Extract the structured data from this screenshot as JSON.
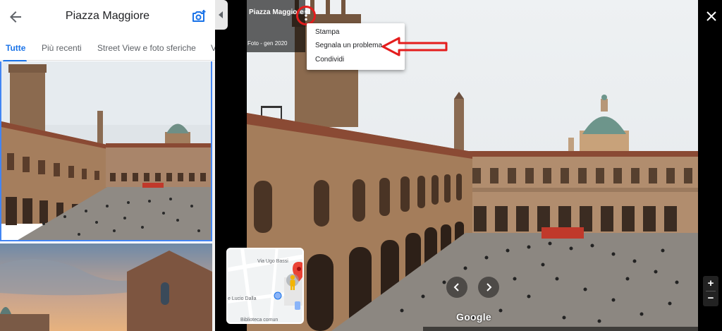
{
  "panel": {
    "title": "Piazza Maggiore",
    "back_icon": "arrow-left-icon",
    "add_photo_icon": "add-photo-icon",
    "tabs": [
      {
        "label": "Tutte",
        "active": true
      },
      {
        "label": "Più recenti",
        "active": false
      },
      {
        "label": "Street View e foto sferiche",
        "active": false
      },
      {
        "label": "V",
        "active": false
      }
    ]
  },
  "viewer": {
    "place_title": "Piazza Maggiore",
    "photo_date": "Foto - gen 2020",
    "menu": {
      "items": [
        "Stampa",
        "Segnala un problema",
        "Condividi"
      ]
    },
    "minimap": {
      "street_label": "Via Ugo Bassi",
      "place_label": "e Lucio Dalla",
      "library_label": "Biblioteca comun"
    },
    "brand": "Google",
    "zoom_in_label": "+",
    "zoom_out_label": "−"
  },
  "colors": {
    "accent": "#1a73e8",
    "annotation_red": "#e41d1d",
    "pegman": "#f4b400",
    "pin": "#ea4335"
  }
}
